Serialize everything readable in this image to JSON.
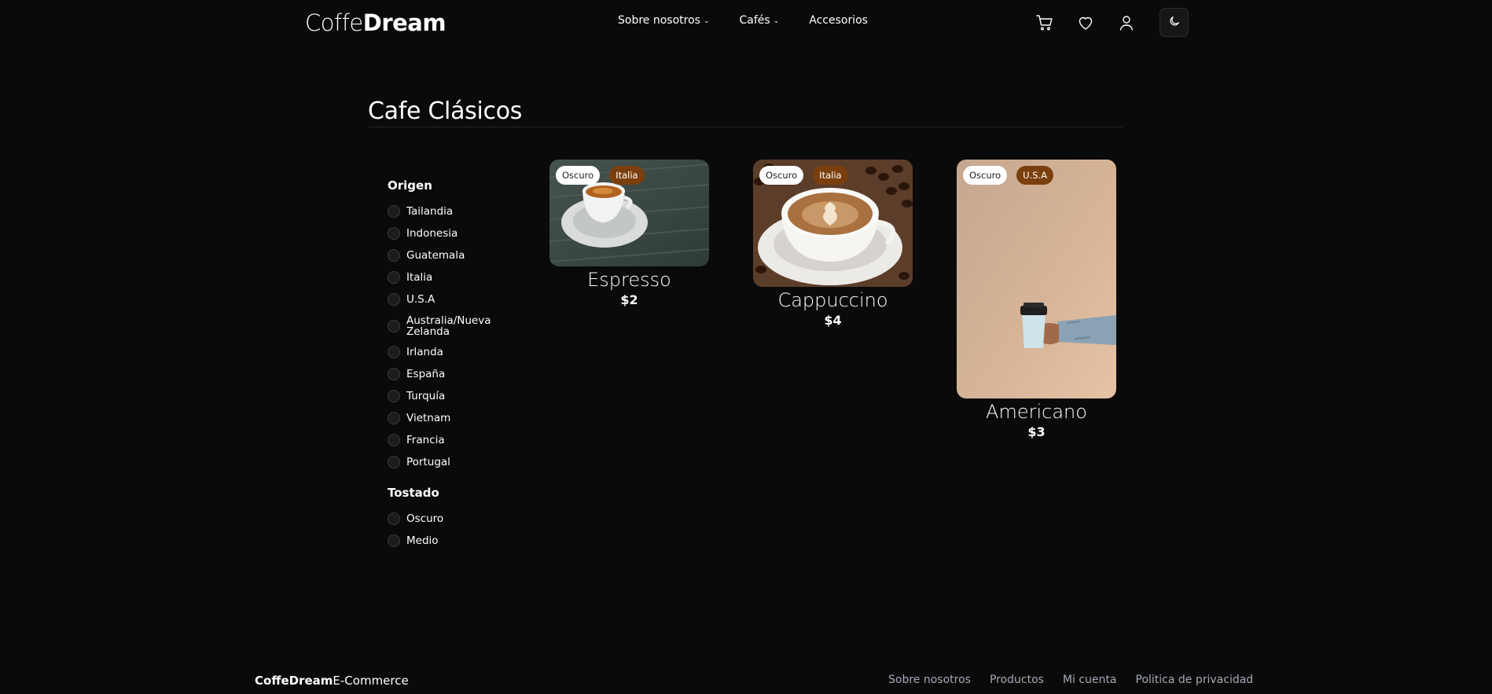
{
  "brand": {
    "name_light": "Coffe",
    "name_bold": "Dream"
  },
  "nav": {
    "items": [
      {
        "label": "Sobre nosotros",
        "has_dropdown": true
      },
      {
        "label": "Cafés",
        "has_dropdown": true
      },
      {
        "label": "Accesorios",
        "has_dropdown": false
      }
    ]
  },
  "header_icons": [
    "cart-icon",
    "heart-icon",
    "user-icon",
    "moon-icon"
  ],
  "page": {
    "title": "Cafe Clásicos"
  },
  "filters": {
    "origin": {
      "heading": "Origen",
      "options": [
        "Tailandia",
        "Indonesia",
        "Guatemala",
        "Italia",
        "U.S.A",
        "Australia/Nueva Zelanda",
        "Irlanda",
        "España",
        "Turquía",
        "Vietnam",
        "Francia",
        "Portugal"
      ]
    },
    "roast": {
      "heading": "Tostado",
      "options": [
        "Oscuro",
        "Medio"
      ]
    }
  },
  "products": [
    {
      "name": "Espresso",
      "price": "$2",
      "roast": "Oscuro",
      "origin": "Italia"
    },
    {
      "name": "Cappuccino",
      "price": "$4",
      "roast": "Oscuro",
      "origin": "Italia"
    },
    {
      "name": "Americano",
      "price": "$3",
      "roast": "Oscuro",
      "origin": "U.S.A"
    }
  ],
  "colors": {
    "background": "#0a0a0a",
    "badge_brown": "#7a3f0c",
    "footer_link": "#a3a9b6"
  },
  "footer": {
    "brand_bold": "CoffeDream",
    "brand_light": "E-Commerce",
    "links": [
      "Sobre nosotros",
      "Productos",
      "Mi cuenta",
      "Politica de privacidad"
    ]
  }
}
